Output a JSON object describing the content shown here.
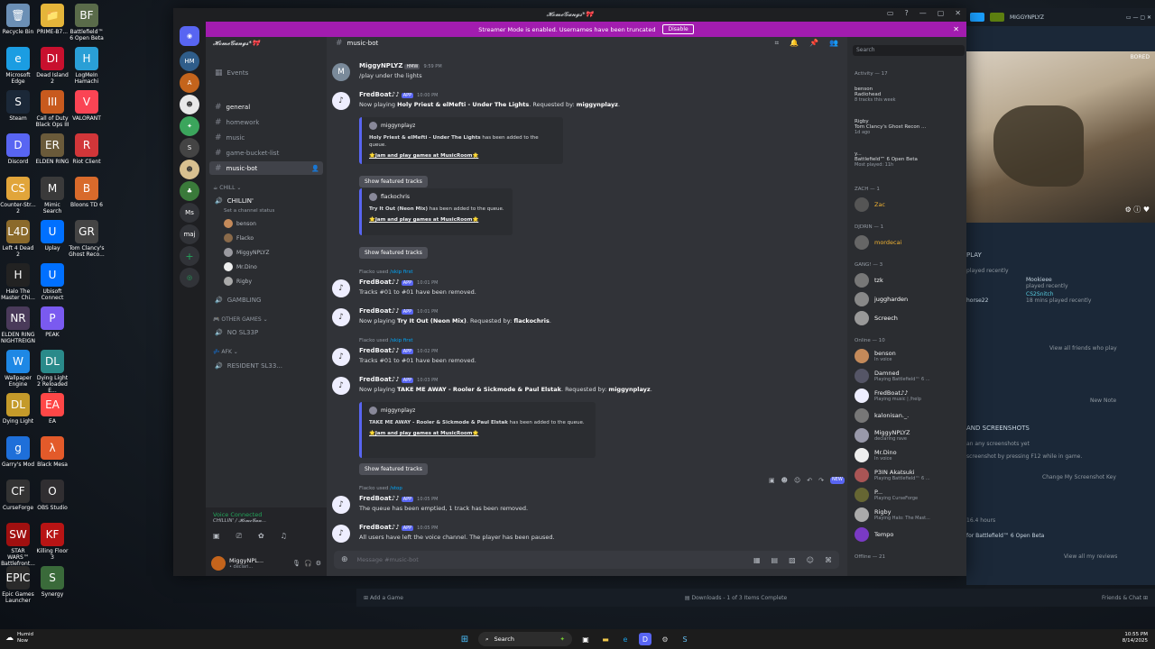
{
  "desktop_icons": [
    {
      "label": "Recycle Bin",
      "color": "#6b8fb5",
      "glyph": "🗑"
    },
    {
      "label": "PRIME-B7...",
      "color": "#e5b53a",
      "glyph": "📁"
    },
    {
      "label": "Battlefield™ 6 Open Beta",
      "color": "#5a6b4a",
      "glyph": "BF"
    },
    {
      "label": "Microsoft Edge",
      "color": "#1b9de2",
      "glyph": "e"
    },
    {
      "label": "Dead Island 2",
      "color": "#c8102e",
      "glyph": "DI"
    },
    {
      "label": "LogMeIn Hamachi",
      "color": "#2a9fd6",
      "glyph": "H"
    },
    {
      "label": "Steam",
      "color": "#1b2838",
      "glyph": "S"
    },
    {
      "label": "Call of Duty Black Ops III",
      "color": "#c85a1e",
      "glyph": "III"
    },
    {
      "label": "VALORANT",
      "color": "#fa4454",
      "glyph": "V"
    },
    {
      "label": "Discord",
      "color": "#5865f2",
      "glyph": "D"
    },
    {
      "label": "ELDEN RING",
      "color": "#6a5a3a",
      "glyph": "ER"
    },
    {
      "label": "Riot Client",
      "color": "#d13639",
      "glyph": "R"
    },
    {
      "label": "Counter-Str... 2",
      "color": "#e1a53a",
      "glyph": "CS"
    },
    {
      "label": "Mimic Search",
      "color": "#3a3a3a",
      "glyph": "M"
    },
    {
      "label": "Bloons TD 6",
      "color": "#d86a2b",
      "glyph": "B"
    },
    {
      "label": "Left 4 Dead 2",
      "color": "#8b6a2b",
      "glyph": "L4D"
    },
    {
      "label": "Uplay",
      "color": "#0070ff",
      "glyph": "U"
    },
    {
      "label": "Tom Clancy's Ghost Reco...",
      "color": "#444",
      "glyph": "GR"
    },
    {
      "label": "Halo The Master Chi...",
      "color": "#222",
      "glyph": "H"
    },
    {
      "label": "Ubisoft Connect",
      "color": "#0070ff",
      "glyph": "U"
    },
    {
      "label": "ELDEN RING NIGHTREIGN",
      "color": "#4a3a5a",
      "glyph": "NR"
    },
    {
      "label": "PEAK",
      "color": "#7a5af0",
      "glyph": "P"
    },
    {
      "label": "Wallpaper Engine",
      "color": "#1e88e5",
      "glyph": "W"
    },
    {
      "label": "Dying Light 2 Reloaded E...",
      "color": "#2a8a8a",
      "glyph": "DL"
    },
    {
      "label": "Dying Light",
      "color": "#c49a2a",
      "glyph": "DL"
    },
    {
      "label": "EA",
      "color": "#ff4747",
      "glyph": "EA"
    },
    {
      "label": "Garry's Mod",
      "color": "#1e6fd9",
      "glyph": "g"
    },
    {
      "label": "Black Mesa",
      "color": "#e35a2a",
      "glyph": "λ"
    },
    {
      "label": "CurseForge",
      "color": "#333",
      "glyph": "CF"
    },
    {
      "label": "OBS Studio",
      "color": "#302e31",
      "glyph": "O"
    },
    {
      "label": "STAR WARS™ Battlefront...",
      "color": "#a01010",
      "glyph": "SW"
    },
    {
      "label": "Killing Floor 3",
      "color": "#b81414",
      "glyph": "KF"
    },
    {
      "label": "Epic Games Launcher",
      "color": "#2a2a2a",
      "glyph": "EPIC"
    },
    {
      "label": "Synergy",
      "color": "#3a6a3a",
      "glyph": "S"
    }
  ],
  "discord": {
    "title": "𝓗𝓸𝓶𝓮𝓖𝓪𝓷𝓰𝓼*🎀",
    "banner": {
      "text": "Streamer Mode is enabled. Usernames have been truncated",
      "button": "Disable"
    },
    "guild_name": "𝓗𝓸𝓶𝓮𝓖𝓪𝓷𝓰𝓼*🎀",
    "events_label": "Events",
    "channels": [
      {
        "name": "general"
      },
      {
        "name": "homework"
      },
      {
        "name": "music"
      },
      {
        "name": "game-bucket-list"
      },
      {
        "name": "music-bot"
      }
    ],
    "cat_chill": "CHILL",
    "voice_chillin": "CHILLIN'",
    "voice_status": "Set a channel status",
    "voice_users": [
      "benson",
      "Flacko",
      "MiggyNPLYZ",
      "Mr.Dino",
      "Rigby"
    ],
    "voice_gambling": "GAMBLING",
    "cat_other": "OTHER GAMES",
    "voice_nosleep": "NO SL33P",
    "cat_afk": "AFK",
    "voice_resident": "RESIDENT SL33...",
    "voice_connected": "Voice Connected",
    "voice_connected_sub": "CHILLIN' / 𝓗𝓸𝓶𝓮𝓖𝓪𝓷...",
    "self_name": "MiggyNPL...",
    "self_status": "• declari...",
    "server_labels": [
      "Ms",
      "maj"
    ],
    "channel_header": "music-bot",
    "search_placeholder": "Search",
    "composer_placeholder": "Message #music-bot",
    "hover_new": "NEW",
    "messages": {
      "m1": {
        "user": "MiggyNPLYZ",
        "tag": "HMW",
        "time": "9:59 PM",
        "text": "/play under the lights"
      },
      "m2": {
        "user": "FredBoat♪♪",
        "tag": "APP",
        "time": "10:00 PM",
        "pre": "Now playing ",
        "bold": "Holy Priest & elMefti - Under The Lights",
        "mid": ". Requested by: ",
        "req": "miggynplayz",
        "end": "."
      },
      "e1": {
        "author": "miggynplayz",
        "desc_bold": "Holy Priest & elMefti - Under The Lights",
        "desc": " has been added to the queue.",
        "link": "🌟Jam and play games at MusicRoom🌟"
      },
      "btn": "Show featured tracks",
      "e2": {
        "author": "flackochris",
        "desc_bold": "Try It Out (Neon Mix)",
        "desc": " has been added to the queue.",
        "link": "🌟Jam and play games at MusicRoom🌟"
      },
      "u1": {
        "pre": "Flacko used ",
        "cmd": "/skip first"
      },
      "m3": {
        "user": "FredBoat♪♪",
        "tag": "APP",
        "time": "10:01 PM",
        "text": "Tracks #01 to #01 have been removed."
      },
      "m4": {
        "user": "FredBoat♪♪",
        "tag": "APP",
        "time": "10:01 PM",
        "pre": "Now playing ",
        "bold": "Try It Out (Neon Mix)",
        "mid": ". Requested by: ",
        "req": "flackochris",
        "end": "."
      },
      "u2": {
        "pre": "Flacko used ",
        "cmd": "/skip first"
      },
      "m5": {
        "user": "FredBoat♪♪",
        "tag": "APP",
        "time": "10:02 PM",
        "text": "Tracks #01 to #01 have been removed."
      },
      "m6": {
        "user": "FredBoat♪♪",
        "tag": "APP",
        "time": "10:03 PM",
        "pre": "Now playing ",
        "bold": "TAKE ME AWAY - Rooler & Sickmode & Paul Elstak",
        "mid": ". Requested by: ",
        "req": "miggynplayz",
        "end": "."
      },
      "e3": {
        "author": "miggynplayz",
        "desc_bold": "TAKE ME AWAY - Rooler & Sickmode & Paul Elstak",
        "desc": " has been added to the queue.",
        "link": "🌟Jam and play games at MusicRoom🌟"
      },
      "u3": {
        "pre": "Flacko used ",
        "cmd": "/stop"
      },
      "m7": {
        "user": "FredBoat♪♪",
        "tag": "APP",
        "time": "10:05 PM",
        "text": "The queue has been emptied, 1 track has been removed."
      },
      "m8": {
        "user": "FredBoat♪♪",
        "tag": "APP",
        "time": "10:05 PM",
        "text": "All users have left the voice channel. The player has been paused."
      }
    },
    "members": {
      "activity_title": "Activity — 17",
      "activity": [
        {
          "name": "benson",
          "game": "Radiohead",
          "sub": "8 tracks this week"
        },
        {
          "name": "Rigby",
          "game": "Tom Clancy's Ghost Recon ...",
          "sub": "1d ago"
        },
        {
          "name": "y...",
          "game": "Battlefield™ 6 Open Beta",
          "sub": "Most played: 11h"
        }
      ],
      "zach_title": "ZACH — 1",
      "zach": [
        "Zac"
      ],
      "djdrin_title": "DJDRIN — 1",
      "djdrin": [
        "mordecai"
      ],
      "gang_title": "GANG! — 3",
      "gang": [
        "tzk",
        "juggharden",
        "Screech"
      ],
      "online_title": "Online — 10",
      "online": [
        {
          "name": "benson",
          "status": "In voice"
        },
        {
          "name": "Damned",
          "status": "Playing Battlefield™ 6 ..."
        },
        {
          "name": "FredBoat♪♪",
          "status": "Playing music | /help"
        },
        {
          "name": "kalonisan._.",
          "status": ""
        },
        {
          "name": "MiggyNPLYZ",
          "status": "declaring rave"
        },
        {
          "name": "Mr.Dino",
          "status": "In voice"
        },
        {
          "name": "P3IN Akatsuki",
          "status": "Playing Battlefield™ 6 ..."
        },
        {
          "name": "P...",
          "status": "Playing CurseForge"
        },
        {
          "name": "Rigby",
          "status": "Playing Halo: The Mast..."
        },
        {
          "name": "Tempo",
          "status": ""
        }
      ],
      "offline_title": "Offline — 21"
    }
  },
  "steam": {
    "user": "MIGGYNPLYZ",
    "bored": "BORED",
    "play": "PLAY",
    "played_recently": "played recently",
    "friends": [
      {
        "name": "Mookieee",
        "sub": "played recently"
      },
      {
        "name": "CS2Snitch",
        "sub": "18 mins played recently"
      },
      {
        "name": "horse22",
        "sub": "played recently"
      }
    ],
    "view_friends": "View all friends who play",
    "new_note": "New Note",
    "screens_title": "AND SCREENSHOTS",
    "screens_1": "an any screenshots yet",
    "screens_2": "screenshot by pressing F12 while in game.",
    "screens_link": "Change My Screenshot Key",
    "hours": "16.4 hours",
    "for_game": "for Battlefield™ 6 Open Beta",
    "reviews": "View all my reviews",
    "add_game": "Add a Game",
    "downloads": "Downloads - 1 of 3 Items Complete",
    "friends_chat": "Friends & Chat"
  },
  "taskbar": {
    "weather": "Humid",
    "weather_sub": "Now",
    "search": "Search",
    "time": "10:55 PM",
    "date": "8/14/2025"
  }
}
